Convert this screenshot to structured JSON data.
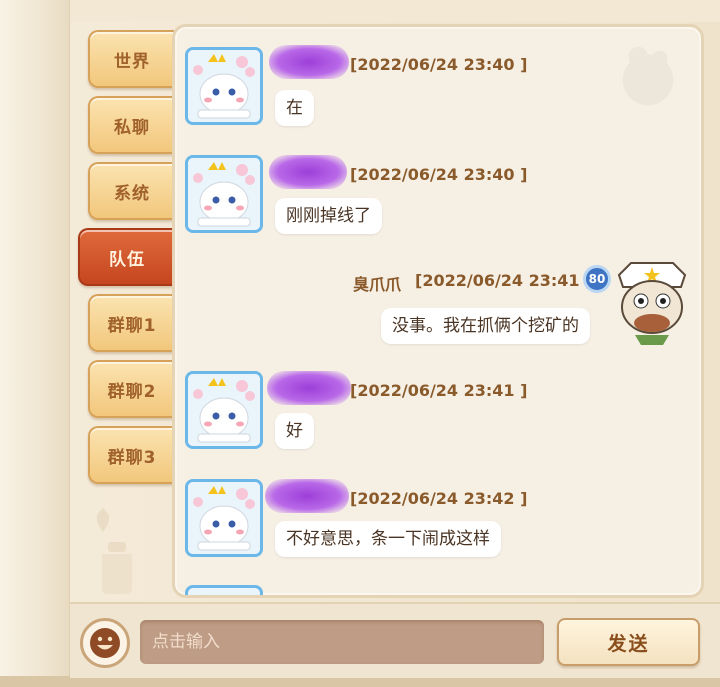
{
  "tabs": [
    {
      "label": "世界"
    },
    {
      "label": "私聊"
    },
    {
      "label": "系统"
    },
    {
      "label": "队伍"
    },
    {
      "label": "群聊1"
    },
    {
      "label": "群聊2"
    },
    {
      "label": "群聊3"
    }
  ],
  "active_tab": "队伍",
  "messages": [
    {
      "timestamp": "[2022/06/24 23:40 ]",
      "text": "在"
    },
    {
      "timestamp": "[2022/06/24 23:40 ]",
      "text": "刚刚掉线了"
    },
    {
      "sender": "臭爪爪",
      "timestamp": "[2022/06/24 23:41 ]",
      "level": "80",
      "text": "没事。我在抓俩个挖矿的"
    },
    {
      "timestamp": "[2022/06/24 23:41 ]",
      "text": "好"
    },
    {
      "timestamp": "[2022/06/24 23:42 ]",
      "text": "不好意思，条一下闹成这样"
    }
  ],
  "input": {
    "placeholder": "点击输入"
  },
  "send_button": {
    "label": "发送"
  },
  "colors": {
    "active_tab": "#c5461f",
    "tab": "#f2c77c",
    "bubble": "#ffffff",
    "timestamp": "#8a5a2b",
    "name_blur": "#9d3fd8"
  },
  "icons": [
    "emoji-face-icon",
    "player-avatar-icon",
    "self-avatar-icon",
    "level-badge-icon"
  ]
}
